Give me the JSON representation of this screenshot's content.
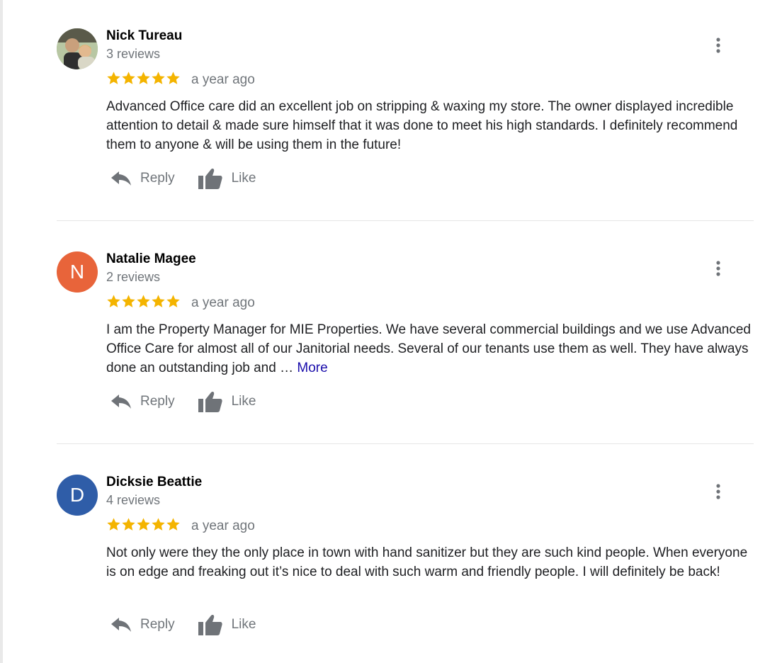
{
  "reviews": [
    {
      "name": "Nick Tureau",
      "review_count": "3 reviews",
      "rating": 5,
      "time": "a year ago",
      "text": "Advanced Office care did an excellent job on stripping & waxing my store.  The owner displayed incredible attention to detail & made sure himself that it was done to meet his high standards.  I definitely recommend them to anyone & will be using them in the future!",
      "more_label": "",
      "avatar_type": "photo",
      "avatar_letter": "",
      "avatar_color": "#9bb59a"
    },
    {
      "name": "Natalie Magee",
      "review_count": "2 reviews",
      "rating": 5,
      "time": "a year ago",
      "text": "I am the Property Manager for MIE Properties. We have several commercial buildings and we use Advanced Office Care for almost all of our Janitorial needs. Several of our tenants use them as well. They have always done an outstanding job and … ",
      "more_label": "More",
      "avatar_type": "letter",
      "avatar_letter": "N",
      "avatar_color": "#e8643a"
    },
    {
      "name": "Dicksie Beattie",
      "review_count": "4 reviews",
      "rating": 5,
      "time": "a year ago",
      "text": "Not only were they the only place in town with hand sanitizer but they are such kind people. When everyone is on edge and freaking out it’s nice to deal with such warm and friendly people. I will definitely be back!",
      "more_label": "",
      "avatar_type": "letter",
      "avatar_letter": "D",
      "avatar_color": "#2f5da8"
    }
  ],
  "actions": {
    "reply_label": "Reply",
    "like_label": "Like",
    "reply_icon": "reply-icon",
    "like_icon": "thumbs-up-icon",
    "menu_icon": "more-vert-icon"
  },
  "colors": {
    "star": "#f4b400",
    "icon_gray": "#6f7378",
    "link": "#1a0dab"
  }
}
